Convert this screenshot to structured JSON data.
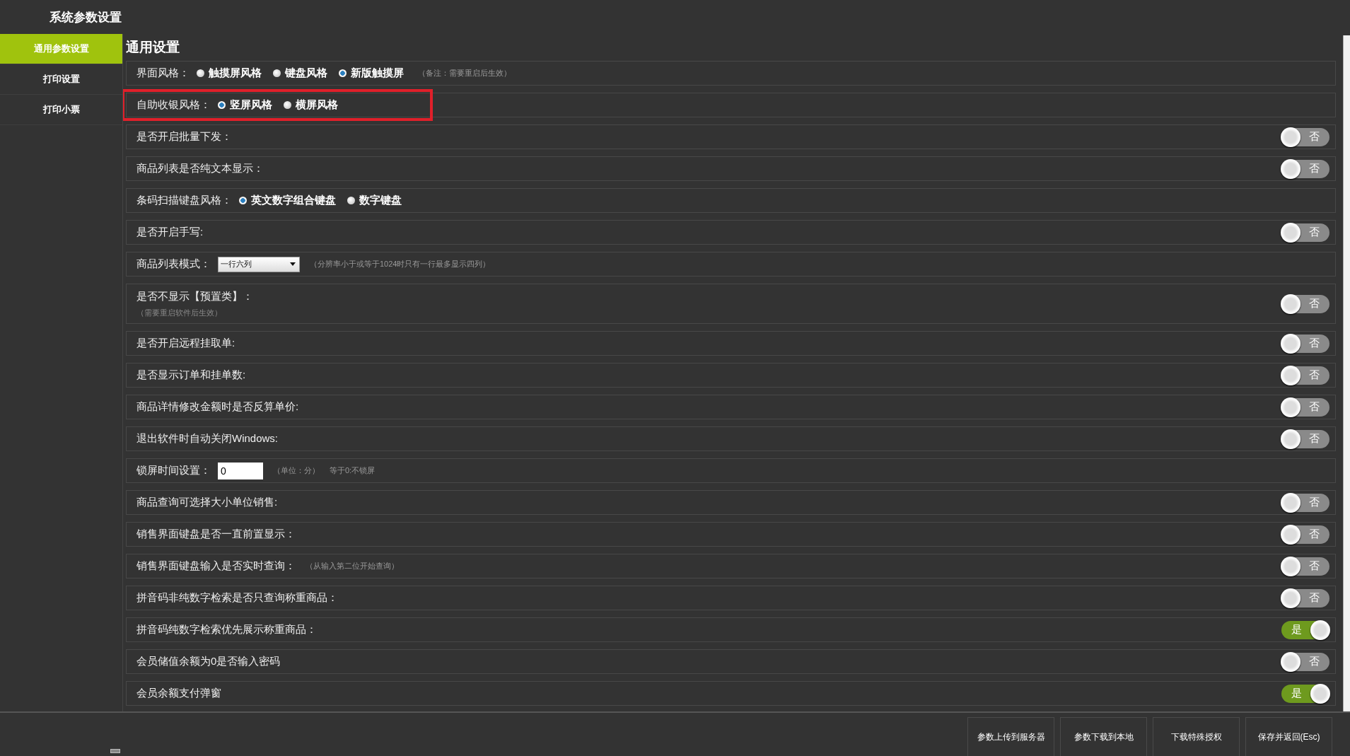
{
  "window": {
    "title": "系统参数设置"
  },
  "sidebar": {
    "items": [
      {
        "label": "通用参数设置",
        "selected": true
      },
      {
        "label": "打印设置",
        "selected": false
      },
      {
        "label": "打印小票",
        "selected": false
      }
    ]
  },
  "section_title": "通用设置",
  "settings": [
    {
      "kind": "radio",
      "label": "界面风格：",
      "highlighted": false,
      "options": [
        {
          "label": "触摸屏风格",
          "selected": false
        },
        {
          "label": "键盘风格",
          "selected": false
        },
        {
          "label": "新版触摸屏",
          "selected": true
        }
      ],
      "note": "（备注：需要重启后生效）"
    },
    {
      "kind": "radio",
      "label": "自助收银风格：",
      "highlighted": true,
      "options": [
        {
          "label": "竖屏风格",
          "selected": true
        },
        {
          "label": "横屏风格",
          "selected": false
        }
      ]
    },
    {
      "kind": "toggle",
      "label": "是否开启批量下发：",
      "highlighted": false,
      "on": false,
      "toggle_text": "否"
    },
    {
      "kind": "toggle",
      "label": "商品列表是否纯文本显示：",
      "highlighted": false,
      "on": false,
      "toggle_text": "否"
    },
    {
      "kind": "radio",
      "label": "条码扫描键盘风格：",
      "highlighted": false,
      "options": [
        {
          "label": "英文数字组合键盘",
          "selected": true
        },
        {
          "label": "数字键盘",
          "selected": false
        }
      ]
    },
    {
      "kind": "toggle",
      "label": "是否开启手写:",
      "highlighted": false,
      "on": false,
      "toggle_text": "否"
    },
    {
      "kind": "select",
      "label": "商品列表模式：",
      "highlighted": false,
      "value": "一行六列",
      "note": "（分辨率小于或等于1024时只有一行最多显示四列）"
    },
    {
      "kind": "toggle",
      "label": "是否不显示【预置类】：",
      "highlighted": false,
      "on": false,
      "toggle_text": "否",
      "sub_note": "（需要重启软件后生效）"
    },
    {
      "kind": "toggle",
      "label": "是否开启远程挂取单:",
      "highlighted": false,
      "on": false,
      "toggle_text": "否"
    },
    {
      "kind": "toggle",
      "label": "是否显示订单和挂单数:",
      "highlighted": false,
      "on": false,
      "toggle_text": "否"
    },
    {
      "kind": "toggle",
      "label": "商品详情修改金额时是否反算单价:",
      "highlighted": false,
      "on": false,
      "toggle_text": "否"
    },
    {
      "kind": "toggle",
      "label": "退出软件时自动关闭Windows:",
      "highlighted": false,
      "on": false,
      "toggle_text": "否"
    },
    {
      "kind": "input",
      "label": "锁屏时间设置：",
      "highlighted": false,
      "value": "0",
      "notes": [
        "（单位：分）",
        "等于0:不锁屏"
      ]
    },
    {
      "kind": "toggle",
      "label": "商品查询可选择大小单位销售:",
      "highlighted": false,
      "on": false,
      "toggle_text": "否"
    },
    {
      "kind": "toggle",
      "label": "销售界面键盘是否一直前置显示：",
      "highlighted": false,
      "on": false,
      "toggle_text": "否"
    },
    {
      "kind": "toggle",
      "label": "销售界面键盘输入是否实时查询：",
      "highlighted": false,
      "on": false,
      "toggle_text": "否",
      "note": "（从输入第二位开始查询）"
    },
    {
      "kind": "toggle",
      "label": "拼音码非纯数字检索是否只查询称重商品：",
      "highlighted": false,
      "on": false,
      "toggle_text": "否"
    },
    {
      "kind": "toggle",
      "label": "拼音码纯数字检索优先展示称重商品：",
      "highlighted": false,
      "on": true,
      "toggle_text": "是"
    },
    {
      "kind": "toggle",
      "label": "会员储值余额为0是否输入密码",
      "highlighted": false,
      "on": false,
      "toggle_text": "否"
    },
    {
      "kind": "toggle",
      "label": "会员余额支付弹窗",
      "highlighted": false,
      "on": true,
      "toggle_text": "是"
    }
  ],
  "footer_buttons": [
    "参数上传到服务器",
    "参数下载到本地",
    "下载特殊授权",
    "保存并返回(Esc)"
  ]
}
